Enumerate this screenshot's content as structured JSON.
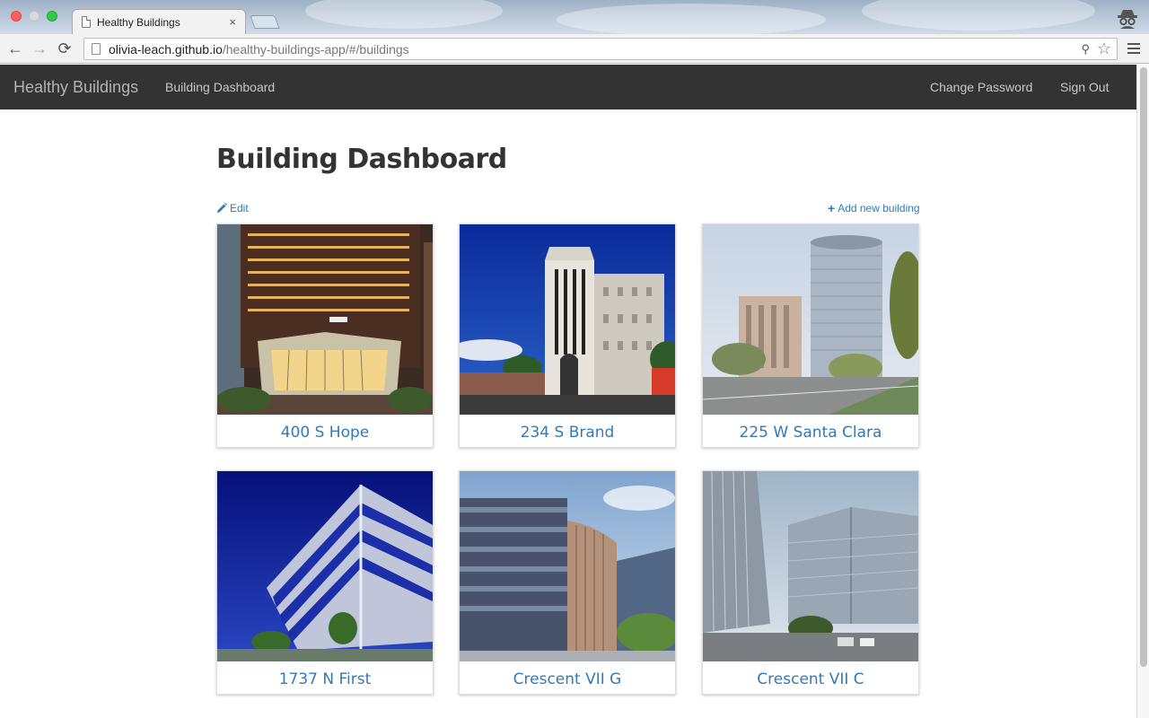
{
  "browser": {
    "tab_title": "Healthy Buildings",
    "tab_close": "×",
    "url_domain": "olivia-leach.github.io",
    "url_path": "/healthy-buildings-app/#/buildings"
  },
  "navbar": {
    "brand": "Healthy Buildings",
    "dashboard_link": "Building Dashboard",
    "change_password": "Change Password",
    "sign_out": "Sign Out"
  },
  "page": {
    "title": "Building Dashboard",
    "edit_label": "Edit",
    "add_label": "Add new building"
  },
  "buildings": [
    {
      "name": "400 S Hope",
      "image": "glass-atrium-tower-dusk"
    },
    {
      "name": "234 S Brand",
      "image": "white-art-deco-building"
    },
    {
      "name": "225 W Santa Clara",
      "image": "twin-office-towers-street"
    },
    {
      "name": "1737 N First",
      "image": "blue-glass-office-building"
    },
    {
      "name": "Crescent VII G",
      "image": "curved-glass-office-buildings"
    },
    {
      "name": "Crescent VII C",
      "image": "glass-tower-street-view"
    }
  ],
  "colors": {
    "navbar_bg": "#333333",
    "link": "#337ab7"
  }
}
